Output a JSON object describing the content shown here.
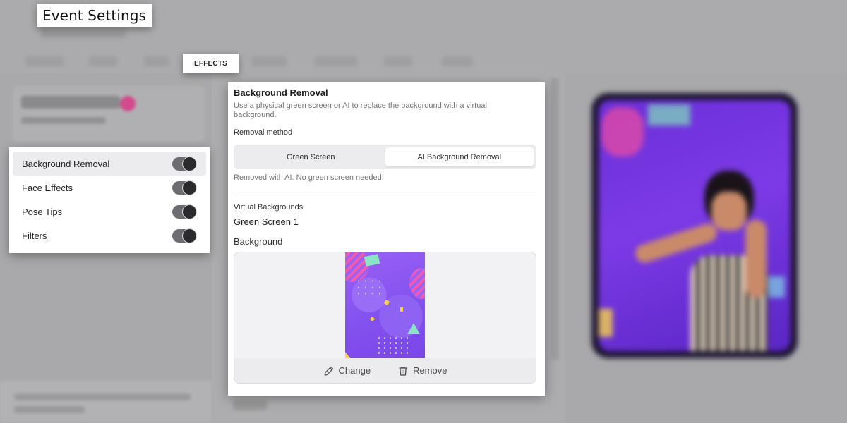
{
  "app": {
    "title": "Event Settings"
  },
  "tabs": {
    "active_label": "EFFECTS"
  },
  "effects_list": [
    {
      "label": "Background Removal",
      "enabled": true,
      "active": true
    },
    {
      "label": "Face Effects",
      "enabled": true,
      "active": false
    },
    {
      "label": "Pose Tips",
      "enabled": true,
      "active": false
    },
    {
      "label": "Filters",
      "enabled": true,
      "active": false
    }
  ],
  "background_removal": {
    "title": "Background Removal",
    "description": "Use a physical green screen or AI to replace the background with a virtual background.",
    "method_label": "Removal method",
    "methods": [
      "Green Screen",
      "AI Background Removal"
    ],
    "selected_method": "AI Background Removal",
    "helper": "Removed with AI. No green screen needed."
  },
  "virtual_backgrounds": {
    "section_label": "Virtual Backgrounds",
    "item_name": "Green Screen 1",
    "background_label": "Background",
    "change_label": "Change",
    "remove_label": "Remove"
  },
  "colors": {
    "accent_pink": "#d34a8d",
    "preview_purple": "#7c3ae6"
  }
}
